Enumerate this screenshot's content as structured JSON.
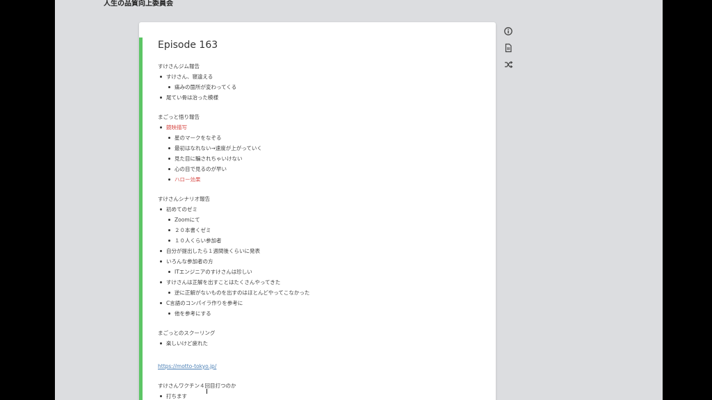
{
  "site": {
    "title": "人生の品質向上委員会"
  },
  "episode": {
    "title": "Episode 163"
  },
  "sections": [
    {
      "heading": "すけさんジム報告",
      "items": [
        {
          "text": "すけさん、寝違える",
          "children": [
            "痛みの箇所が変わってくる"
          ]
        },
        {
          "text": "尾てい骨は治った模様",
          "children": []
        }
      ]
    },
    {
      "heading": "まごっと悟り報告",
      "items": [
        {
          "text": "鏡映描写",
          "children": [
            "星のマークをなぞる",
            "最初はなれない→速度が上がっていく",
            "見た目に騙されちゃいけない",
            "心の目で見るのが早い",
            "ハロー効果"
          ]
        }
      ]
    },
    {
      "heading": "すけさんシナリオ報告",
      "items": [
        {
          "text": "初めてのゼミ",
          "children": [
            "Zoomにて",
            "２０本書くゼミ",
            "１０人くらい参加者"
          ]
        },
        {
          "text": "自分が提出したら１週間後くらいに発表",
          "children": []
        },
        {
          "text": "いろんな参加者の方",
          "children": [
            "ITエンジニアのすけさんは珍しい"
          ]
        },
        {
          "text": "すけさんは正解を出すことはたくさんやってきた",
          "children": [
            "逆に正解がないものを出すのはほとんどやってこなかった"
          ]
        },
        {
          "text": "C言語のコンパイラ作りを参考に",
          "children": [
            "他を参考にする"
          ]
        }
      ]
    },
    {
      "heading": "まごっとのスクーリング",
      "items": [
        {
          "text": "楽しいけど疲れた",
          "children": []
        }
      ]
    }
  ],
  "link": {
    "text": "https://motto-tokyo.jp/"
  },
  "last_section": {
    "heading": "すけさんワクチン４回目打つのか",
    "items": [
      "打ちます"
    ]
  },
  "icons": {
    "info": "info-icon",
    "document": "document-icon",
    "shuffle": "shuffle-icon"
  },
  "colors": {
    "accent": "#5cc565",
    "highlight": "#d9534f",
    "link": "#4a7fb5"
  }
}
